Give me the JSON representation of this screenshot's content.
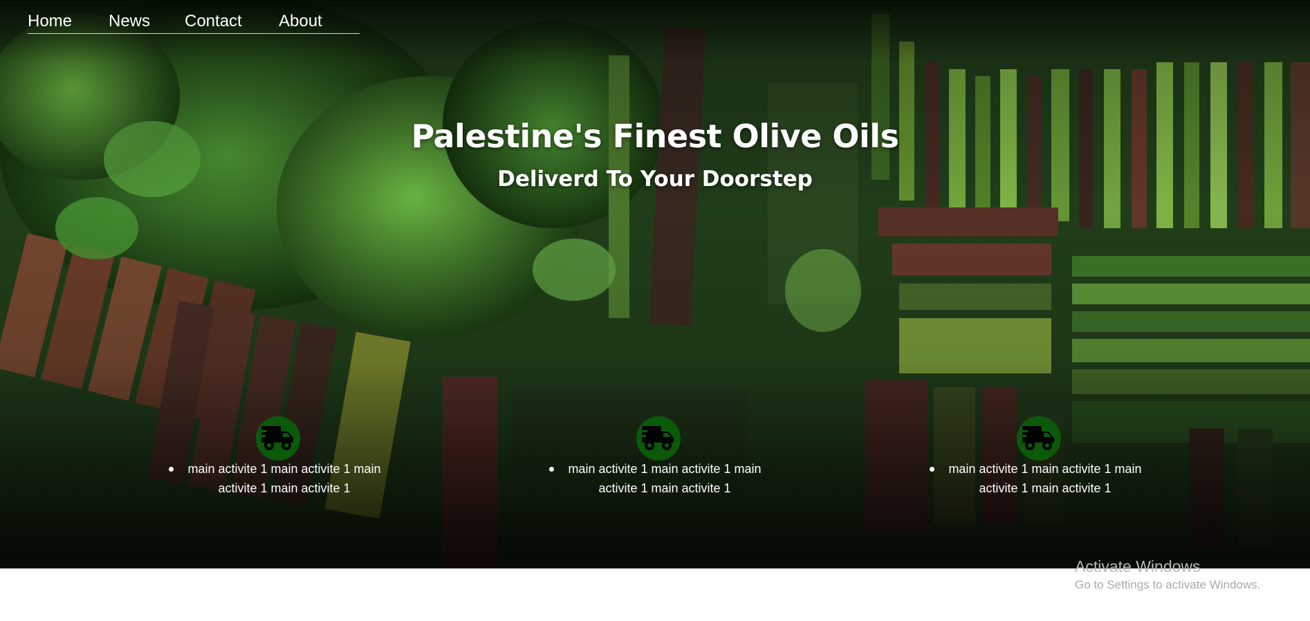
{
  "nav": {
    "items": [
      {
        "label": "Home"
      },
      {
        "label": "News"
      },
      {
        "label": "Contact"
      },
      {
        "label": "About"
      }
    ]
  },
  "hero": {
    "title": "Palestine's Finest Olive Oils",
    "subtitle": "Deliverd To Your Doorstep"
  },
  "features": [
    {
      "icon": "truck-icon",
      "text": "main activite 1 main activite 1 main activite 1 main activite 1"
    },
    {
      "icon": "truck-icon",
      "text": "main activite 1 main activite 1 main activite 1 main activite 1"
    },
    {
      "icon": "truck-icon",
      "text": "main activite 1 main activite 1 main activite 1 main activite 1"
    }
  ],
  "watermark": {
    "title": "Activate Windows",
    "subtitle": "Go to Settings to activate Windows."
  },
  "colors": {
    "icon_circle": "#0a5a0a",
    "text": "#ffffff",
    "background_below": "#ffffff"
  }
}
